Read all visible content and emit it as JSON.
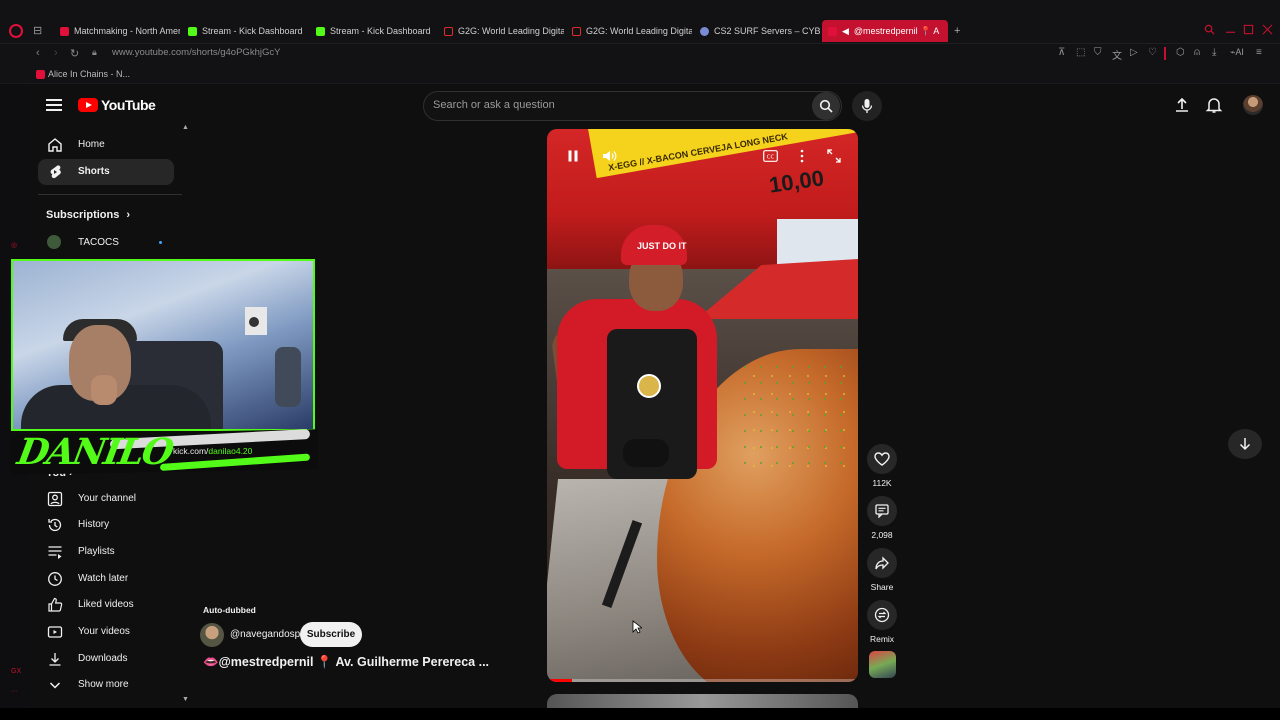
{
  "browser": {
    "tabs": [
      {
        "label": "Matchmaking - North Amer",
        "favicon": "red-arrow"
      },
      {
        "label": "Stream - Kick Dashboard",
        "favicon": "kick"
      },
      {
        "label": "Stream - Kick Dashboard",
        "favicon": "kick"
      },
      {
        "label": "G2G: World Leading Digita",
        "favicon": "g2g"
      },
      {
        "label": "G2G: World Leading Digita",
        "favicon": "g2g"
      },
      {
        "label": "CS2 SURF Servers – CYBE",
        "favicon": "cs"
      },
      {
        "label": "@mestredpernil 📍 A",
        "favicon": "youtube",
        "active": true
      }
    ],
    "url": "www.youtube.com/shorts/g4oPGkhjGcY",
    "bookmark": "Alice In Chains - N...",
    "ai_label": "AI",
    "accent": "#c4112f"
  },
  "youtube": {
    "logo_text": "YouTube",
    "search_placeholder": "Search or ask a question",
    "sidebar": {
      "home": "Home",
      "shorts": "Shorts",
      "subscriptions": "Subscriptions",
      "subscription_channel": "TACOCS",
      "you": "You",
      "your_channel": "Your channel",
      "history": "History",
      "playlists": "Playlists",
      "watch_later": "Watch later",
      "liked_videos": "Liked videos",
      "your_videos": "Your videos",
      "downloads": "Downloads",
      "show_more": "Show more"
    },
    "short": {
      "auto_dubbed": "Auto-dubbed",
      "channel": "@navegandosp",
      "subscribe": "Subscribe",
      "title": "👄@mestredpernil 📍 Av. Guilherme Perereca ...",
      "likes": "112K",
      "comments": "2,098",
      "share": "Share",
      "remix": "Remix",
      "progress": 0.08
    },
    "video_text": {
      "price": "10,00",
      "sign": "X-EGG // X-BACON  CERVEJA LONG NECK",
      "cap": "JUST DO IT"
    }
  },
  "overlay": {
    "streamer_name": "DANILO",
    "kick_url_prefix": "kick.com/",
    "kick_url_user": "danilao4.20"
  }
}
